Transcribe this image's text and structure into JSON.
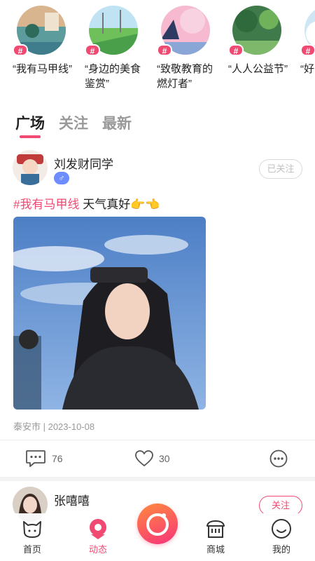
{
  "topics": [
    {
      "hash": "#",
      "label": "“我有马甲线”"
    },
    {
      "hash": "#",
      "label": "“身边的美食鉴赏”"
    },
    {
      "hash": "#",
      "label": "“致敬教育的燃灯者”"
    },
    {
      "hash": "#",
      "label": "“人人公益节”"
    },
    {
      "hash": "#",
      "label": "“好图鉴"
    }
  ],
  "tabs": [
    "广场",
    "关注",
    "最新"
  ],
  "post1": {
    "username": "刘发财同学",
    "gender_symbol": "♂",
    "follow_label": "已关注",
    "tag": "#我有马甲线",
    "text": " 天气真好👉👈",
    "meta": "泰安市 | 2023-10-08",
    "comments": "76",
    "likes": "30"
  },
  "post2": {
    "username": "张嘻嘻",
    "follow_label": "关注"
  },
  "nav": [
    {
      "label": "首页"
    },
    {
      "label": "动态"
    },
    {
      "label": "商城"
    },
    {
      "label": "我的"
    }
  ],
  "colors": {
    "accent": "#f04a72",
    "male": "#6c8cff"
  }
}
